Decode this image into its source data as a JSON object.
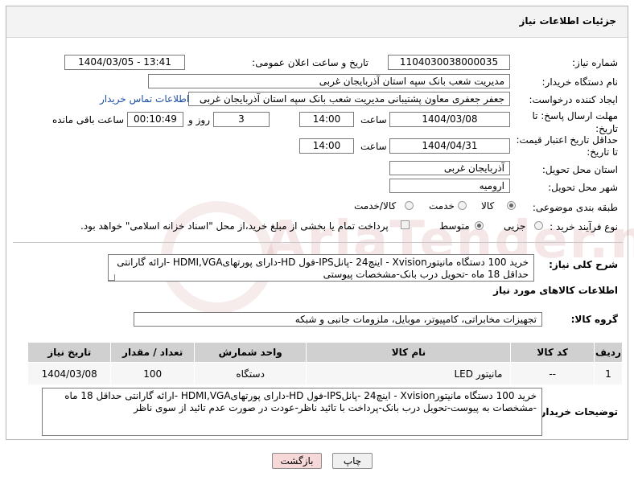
{
  "header": {
    "title": "جزئیات اطلاعات نیاز"
  },
  "form": {
    "need_number_label": "شماره نیاز:",
    "need_number": "1104030038000035",
    "announce_label": "تاریخ و ساعت اعلان عمومی:",
    "announce_value": "1404/03/05 - 13:41",
    "buyer_org_label": "نام دستگاه خریدار:",
    "buyer_org": "مدیریت شعب بانک سپه استان آذربایجان غربی",
    "creator_label": "ایجاد کننده درخواست:",
    "creator": "جعفر جعفری معاون پشتیبانی مدیریت شعب بانک سپه استان آذربایجان غربی",
    "contact_link": "اطلاعات تماس خریدار",
    "deadline_label": "مهلت ارسال پاسخ: تا تاریخ:",
    "deadline_date": "1404/03/08",
    "time_label": "ساعت",
    "deadline_time": "14:00",
    "days_value": "3",
    "days_label": "روز و",
    "remaining_time": "00:10:49",
    "remaining_label": "ساعت باقی مانده",
    "validity_label": "حداقل تاریخ اعتبار قیمت: تا تاریخ:",
    "validity_date": "1404/04/31",
    "validity_time": "14:00",
    "province_label": "استان محل تحویل:",
    "province": "آذربایجان غربی",
    "city_label": "شهر محل تحویل:",
    "city": "ارومیه",
    "category_label": "طبقه بندی موضوعی:",
    "category_options": [
      "کالا",
      "خدمت",
      "کالا/خدمت"
    ],
    "process_label": "نوع فرآیند خرید :",
    "process_options": [
      "جزیی",
      "متوسط"
    ],
    "payment_note": "پرداخت تمام یا بخشی از مبلغ خرید،از محل \"اسناد خزانه اسلامی\" خواهد بود."
  },
  "description": {
    "label": "شرح کلی نیاز:",
    "text": "خرید 100 دستگاه مانیتورXvision - اینچ24  -پانلIPS-فول HD-دارای پورتهایHDMI,VGA -ارائه گارانتی حداقل 18 ماه -تحویل درب بانک-مشخصات پیوستی"
  },
  "goods": {
    "section_title": "اطلاعات کالاهای مورد نیاز",
    "group_label": "گروه کالا:",
    "group_value": "تجهیزات مخابراتی، کامپیوتر، موبایل، ملزومات جانبی و شبکه",
    "columns": [
      "ردیف",
      "کد کالا",
      "نام کالا",
      "واحد شمارش",
      "تعداد / مقدار",
      "تاریخ نیاز"
    ],
    "rows": [
      {
        "row": "1",
        "code": "--",
        "name": "مانیتور LED",
        "unit": "دستگاه",
        "qty": "100",
        "date": "1404/03/08"
      }
    ]
  },
  "buyer_notes": {
    "label": "توضیحات خریدار:",
    "text": "خرید 100 دستگاه مانیتورXvision - اینچ24  -پانلIPS-فول HD-دارای پورتهایHDMI,VGA -ارائه گارانتی حداقل 18 ماه -مشخصات به پیوست-تحویل درب بانک-پرداخت با تائید ناظر-عودت در صورت عدم تائید از سوی ناظر"
  },
  "buttons": {
    "print": "چاپ",
    "back": "بازگشت"
  },
  "watermark": "AriaTender.neT",
  "colors": {
    "link": "#1a4fa3",
    "back_button": "#f6d8d8",
    "table_header": "#d0d0d0"
  }
}
